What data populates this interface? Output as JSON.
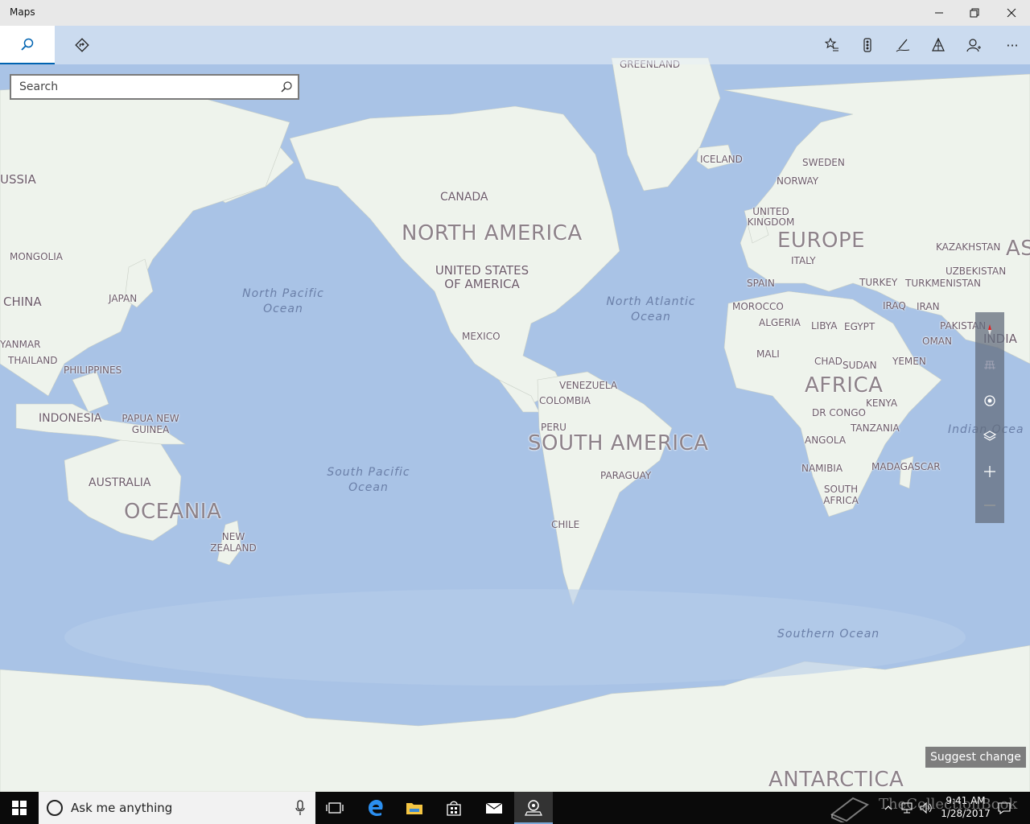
{
  "window": {
    "title": "Maps",
    "minimize_icon": "minimize-icon",
    "maximize_icon": "restore-icon",
    "close_icon": "close-icon"
  },
  "toolbar": {
    "tabs": [
      {
        "name": "search",
        "icon": "search-icon",
        "active": true
      },
      {
        "name": "directions",
        "icon": "directions-icon",
        "active": false
      }
    ],
    "tools": [
      {
        "name": "favorites",
        "icon": "favorites-icon"
      },
      {
        "name": "traffic",
        "icon": "traffic-icon"
      },
      {
        "name": "ink",
        "icon": "pen-icon"
      },
      {
        "name": "3d-cities",
        "icon": "city-icon"
      },
      {
        "name": "account",
        "icon": "person-icon"
      },
      {
        "name": "more",
        "icon": "more-icon",
        "label": "···"
      }
    ]
  },
  "search": {
    "placeholder": "Search"
  },
  "map": {
    "continents": [
      "NORTH AMERICA",
      "SOUTH AMERICA",
      "EUROPE",
      "AFRICA",
      "OCEANIA",
      "ANTARCTICA",
      "AS"
    ],
    "countries": [
      "GREENLAND",
      "ICELAND",
      "SWEDEN",
      "NORWAY",
      "UNITED KINGDOM",
      "KAZAKHSTAN",
      "ITALY",
      "SPAIN",
      "TURKEY",
      "UZBEKISTAN",
      "TURKMENISTAN",
      "MOROCCO",
      "IRAQ",
      "IRAN",
      "ALGERIA",
      "LIBYA",
      "EGYPT",
      "PAKISTAN",
      "OMAN",
      "INDIA",
      "MALI",
      "CHAD",
      "SUDAN",
      "YEMEN",
      "KENYA",
      "DR CONGO",
      "TANZANIA",
      "ANGOLA",
      "NAMIBIA",
      "MADAGASCAR",
      "SOUTH AFRICA",
      "CANADA",
      "UNITED STATES OF AMERICA",
      "MEXICO",
      "VENEZUELA",
      "COLOMBIA",
      "PERU",
      "PARAGUAY",
      "CHILE",
      "USSIA",
      "MONGOLIA",
      "CHINA",
      "JAPAN",
      "YANMAR",
      "THAILAND",
      "PHILIPPINES",
      "INDONESIA",
      "PAPUA NEW GUINEA",
      "AUSTRALIA",
      "NEW ZEALAND"
    ],
    "oceans": [
      "North Pacific Ocean",
      "North Atlantic Ocean",
      "South Pacific Ocean",
      "Southern Ocean",
      "Indian Ocea"
    ]
  },
  "map_controls": [
    "compass-icon",
    "tilt-icon",
    "locate-icon",
    "layers-icon",
    "zoom-in-icon",
    "zoom-out-icon"
  ],
  "suggest_change": "Suggest change",
  "taskbar": {
    "search_placeholder": "Ask me anything",
    "time": "9:41 AM",
    "date": "1/28/2017",
    "watermark": "TheCollectionBook"
  },
  "colors": {
    "ocean": "#a9c3e6",
    "land": "#eef3ec",
    "accent": "#0063b1",
    "taskbar": "#0a0a0a"
  }
}
